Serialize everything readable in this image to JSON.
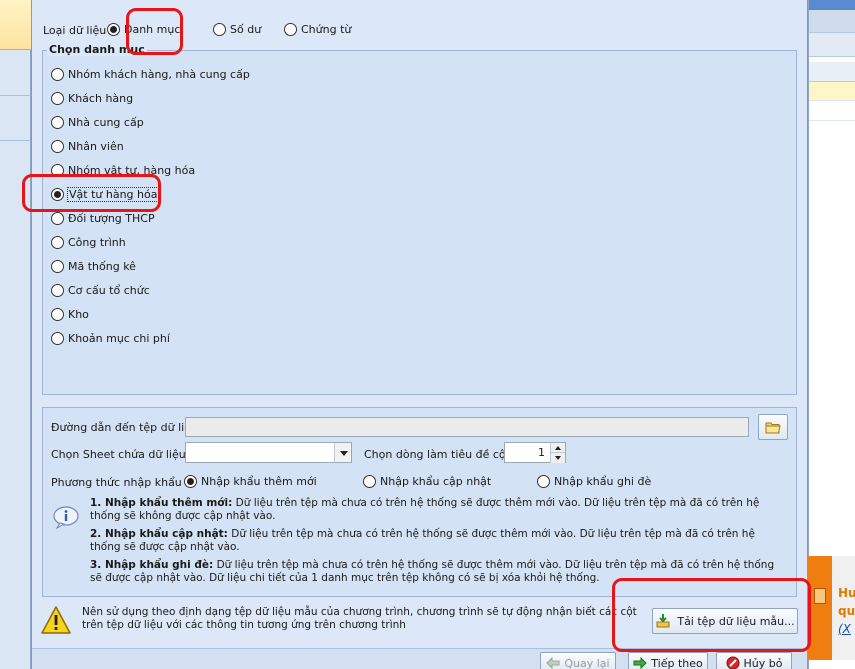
{
  "data_type": {
    "label": "Loại dữ liệu",
    "options": [
      "Danh mục",
      "Số dư",
      "Chứng từ"
    ],
    "selected": 0
  },
  "category": {
    "legend": "Chọn danh mục",
    "items": [
      "Nhóm khách hàng, nhà cung cấp",
      "Khách hàng",
      "Nhà cung cấp",
      "Nhân viên",
      "Nhóm vật tư, hàng hóa",
      "Vật tư hàng hóa",
      "Đối tượng THCP",
      "Công trình",
      "Mã thống kê",
      "Cơ cấu tổ chức",
      "Kho",
      "Khoản mục chi phí"
    ],
    "selected": 5
  },
  "file": {
    "path_label": "Đường dẫn đến tệp dữ liệu",
    "path_value": "",
    "sheet_label": "Chọn Sheet chứa dữ liệu",
    "sheet_value": "",
    "header_row_label": "Chọn dòng làm tiêu đề cột",
    "header_row_value": "1"
  },
  "import_method": {
    "label": "Phương thức nhập khẩu",
    "options": [
      "Nhập khẩu thêm mới",
      "Nhập khẩu cập nhật",
      "Nhập khẩu ghi đè"
    ],
    "selected": 0
  },
  "notes": [
    {
      "title": "1. Nhập khẩu thêm mới:",
      "text": " Dữ liệu trên tệp mà chưa có trên hệ thống sẽ được thêm mới vào. Dữ liệu trên tệp mà đã có trên hệ thống sẽ không được cập nhật vào."
    },
    {
      "title": "2. Nhập khẩu cập nhật:",
      "text": " Dữ liệu trên tệp mà chưa có trên hệ thống sẽ được thêm mới vào. Dữ liệu trên tệp mà đã có trên hệ thống sẽ được cập nhật vào."
    },
    {
      "title": "3. Nhập khẩu ghi đè:",
      "text": " Dữ liệu trên tệp mà chưa có trên hệ thống sẽ được thêm mới vào. Dữ liệu trên tệp mà đã có trên hệ thống sẽ được cập nhật vào. Dữ liệu chi tiết của 1 danh mục trên tệp không có sẽ bị xóa khỏi hệ thống."
    }
  ],
  "warning_text": "Nên sử dụng theo định dạng tệp dữ liệu mẫu của chương trình, chương trình sẽ tự động nhận biết các cột trên tệp dữ liệu với các thông tin tương ứng trên chương trình",
  "buttons": {
    "download_template": "Tải tệp dữ liệu mẫu...",
    "back": "Quay lại",
    "next": "Tiếp theo",
    "cancel": "Hủy bỏ"
  },
  "background": {
    "ad_line1": "Hư",
    "ad_line2": "qu",
    "ad_link": "(X"
  },
  "colors": {
    "highlight_circle": "#e8141a",
    "dialog_bg": "#dce8f7",
    "ad_orange": "#ef7d10"
  },
  "icons": [
    "folder-icon",
    "info-icon",
    "warning-icon",
    "download-template-icon",
    "back-arrow-icon",
    "next-arrow-icon",
    "cancel-icon"
  ]
}
